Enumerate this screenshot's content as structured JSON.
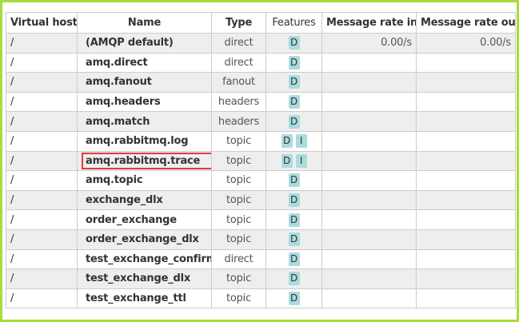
{
  "table": {
    "headers": {
      "vhost": "Virtual host",
      "name": "Name",
      "type": "Type",
      "features": "Features",
      "rate_in": "Message rate in",
      "rate_out": "Message rate out"
    },
    "rows": [
      {
        "vhost": "/",
        "name": "(AMQP default)",
        "type": "direct",
        "features": [
          "D"
        ],
        "rate_in": "0.00/s",
        "rate_out": "0.00/s",
        "highlighted": false
      },
      {
        "vhost": "/",
        "name": "amq.direct",
        "type": "direct",
        "features": [
          "D"
        ],
        "rate_in": "",
        "rate_out": "",
        "highlighted": false
      },
      {
        "vhost": "/",
        "name": "amq.fanout",
        "type": "fanout",
        "features": [
          "D"
        ],
        "rate_in": "",
        "rate_out": "",
        "highlighted": false
      },
      {
        "vhost": "/",
        "name": "amq.headers",
        "type": "headers",
        "features": [
          "D"
        ],
        "rate_in": "",
        "rate_out": "",
        "highlighted": false
      },
      {
        "vhost": "/",
        "name": "amq.match",
        "type": "headers",
        "features": [
          "D"
        ],
        "rate_in": "",
        "rate_out": "",
        "highlighted": false
      },
      {
        "vhost": "/",
        "name": "amq.rabbitmq.log",
        "type": "topic",
        "features": [
          "D",
          "I"
        ],
        "rate_in": "",
        "rate_out": "",
        "highlighted": false
      },
      {
        "vhost": "/",
        "name": "amq.rabbitmq.trace",
        "type": "topic",
        "features": [
          "D",
          "I"
        ],
        "rate_in": "",
        "rate_out": "",
        "highlighted": true
      },
      {
        "vhost": "/",
        "name": "amq.topic",
        "type": "topic",
        "features": [
          "D"
        ],
        "rate_in": "",
        "rate_out": "",
        "highlighted": false
      },
      {
        "vhost": "/",
        "name": "exchange_dlx",
        "type": "topic",
        "features": [
          "D"
        ],
        "rate_in": "",
        "rate_out": "",
        "highlighted": false
      },
      {
        "vhost": "/",
        "name": "order_exchange",
        "type": "topic",
        "features": [
          "D"
        ],
        "rate_in": "",
        "rate_out": "",
        "highlighted": false
      },
      {
        "vhost": "/",
        "name": "order_exchange_dlx",
        "type": "topic",
        "features": [
          "D"
        ],
        "rate_in": "",
        "rate_out": "",
        "highlighted": false
      },
      {
        "vhost": "/",
        "name": "test_exchange_confirm",
        "type": "direct",
        "features": [
          "D"
        ],
        "rate_in": "",
        "rate_out": "",
        "highlighted": false
      },
      {
        "vhost": "/",
        "name": "test_exchange_dlx",
        "type": "topic",
        "features": [
          "D"
        ],
        "rate_in": "",
        "rate_out": "",
        "highlighted": false
      },
      {
        "vhost": "/",
        "name": "test_exchange_ttl",
        "type": "topic",
        "features": [
          "D"
        ],
        "rate_in": "",
        "rate_out": "",
        "highlighted": false
      }
    ]
  },
  "colors": {
    "frame_border": "#a6dd3c",
    "feature_badge": "#aadcdd",
    "alt_row": "#eeeeee",
    "highlight_box": "#e03c3c"
  }
}
